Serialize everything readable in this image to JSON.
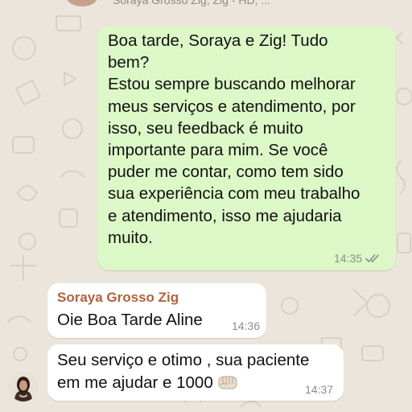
{
  "header": {
    "title": "Soraya Grosso Zig, Zig - HD, ..."
  },
  "messages": [
    {
      "direction": "outgoing",
      "text": "Boa tarde, Soraya e Zig! Tudo\nbem?\nEstou sempre buscando melhorar\nmeus serviços e atendimento, por\nisso, seu feedback é muito\nimportante para mim. Se você\npuder me contar, como tem sido\nsua experiência com meu trabalho\ne atendimento, isso me ajudaria\nmuito.",
      "time": "14:35",
      "status_icon": "double-check-icon"
    },
    {
      "direction": "incoming",
      "sender": "Soraya Grosso Zig",
      "text": "Oie Boa Tarde Aline",
      "time": "14:36"
    },
    {
      "direction": "incoming",
      "text": "Seu serviço e otimo , sua paciente\nem me ajudar e 1000",
      "emoji_icon": "fist-emoji-icon",
      "time": "14:37"
    }
  ],
  "colors": {
    "chat_background": "#ece5dc",
    "outgoing_bubble": "#dcf8c6",
    "incoming_bubble": "#ffffff",
    "sender_name": "#b0623e",
    "timestamp": "#8a8f8a"
  }
}
